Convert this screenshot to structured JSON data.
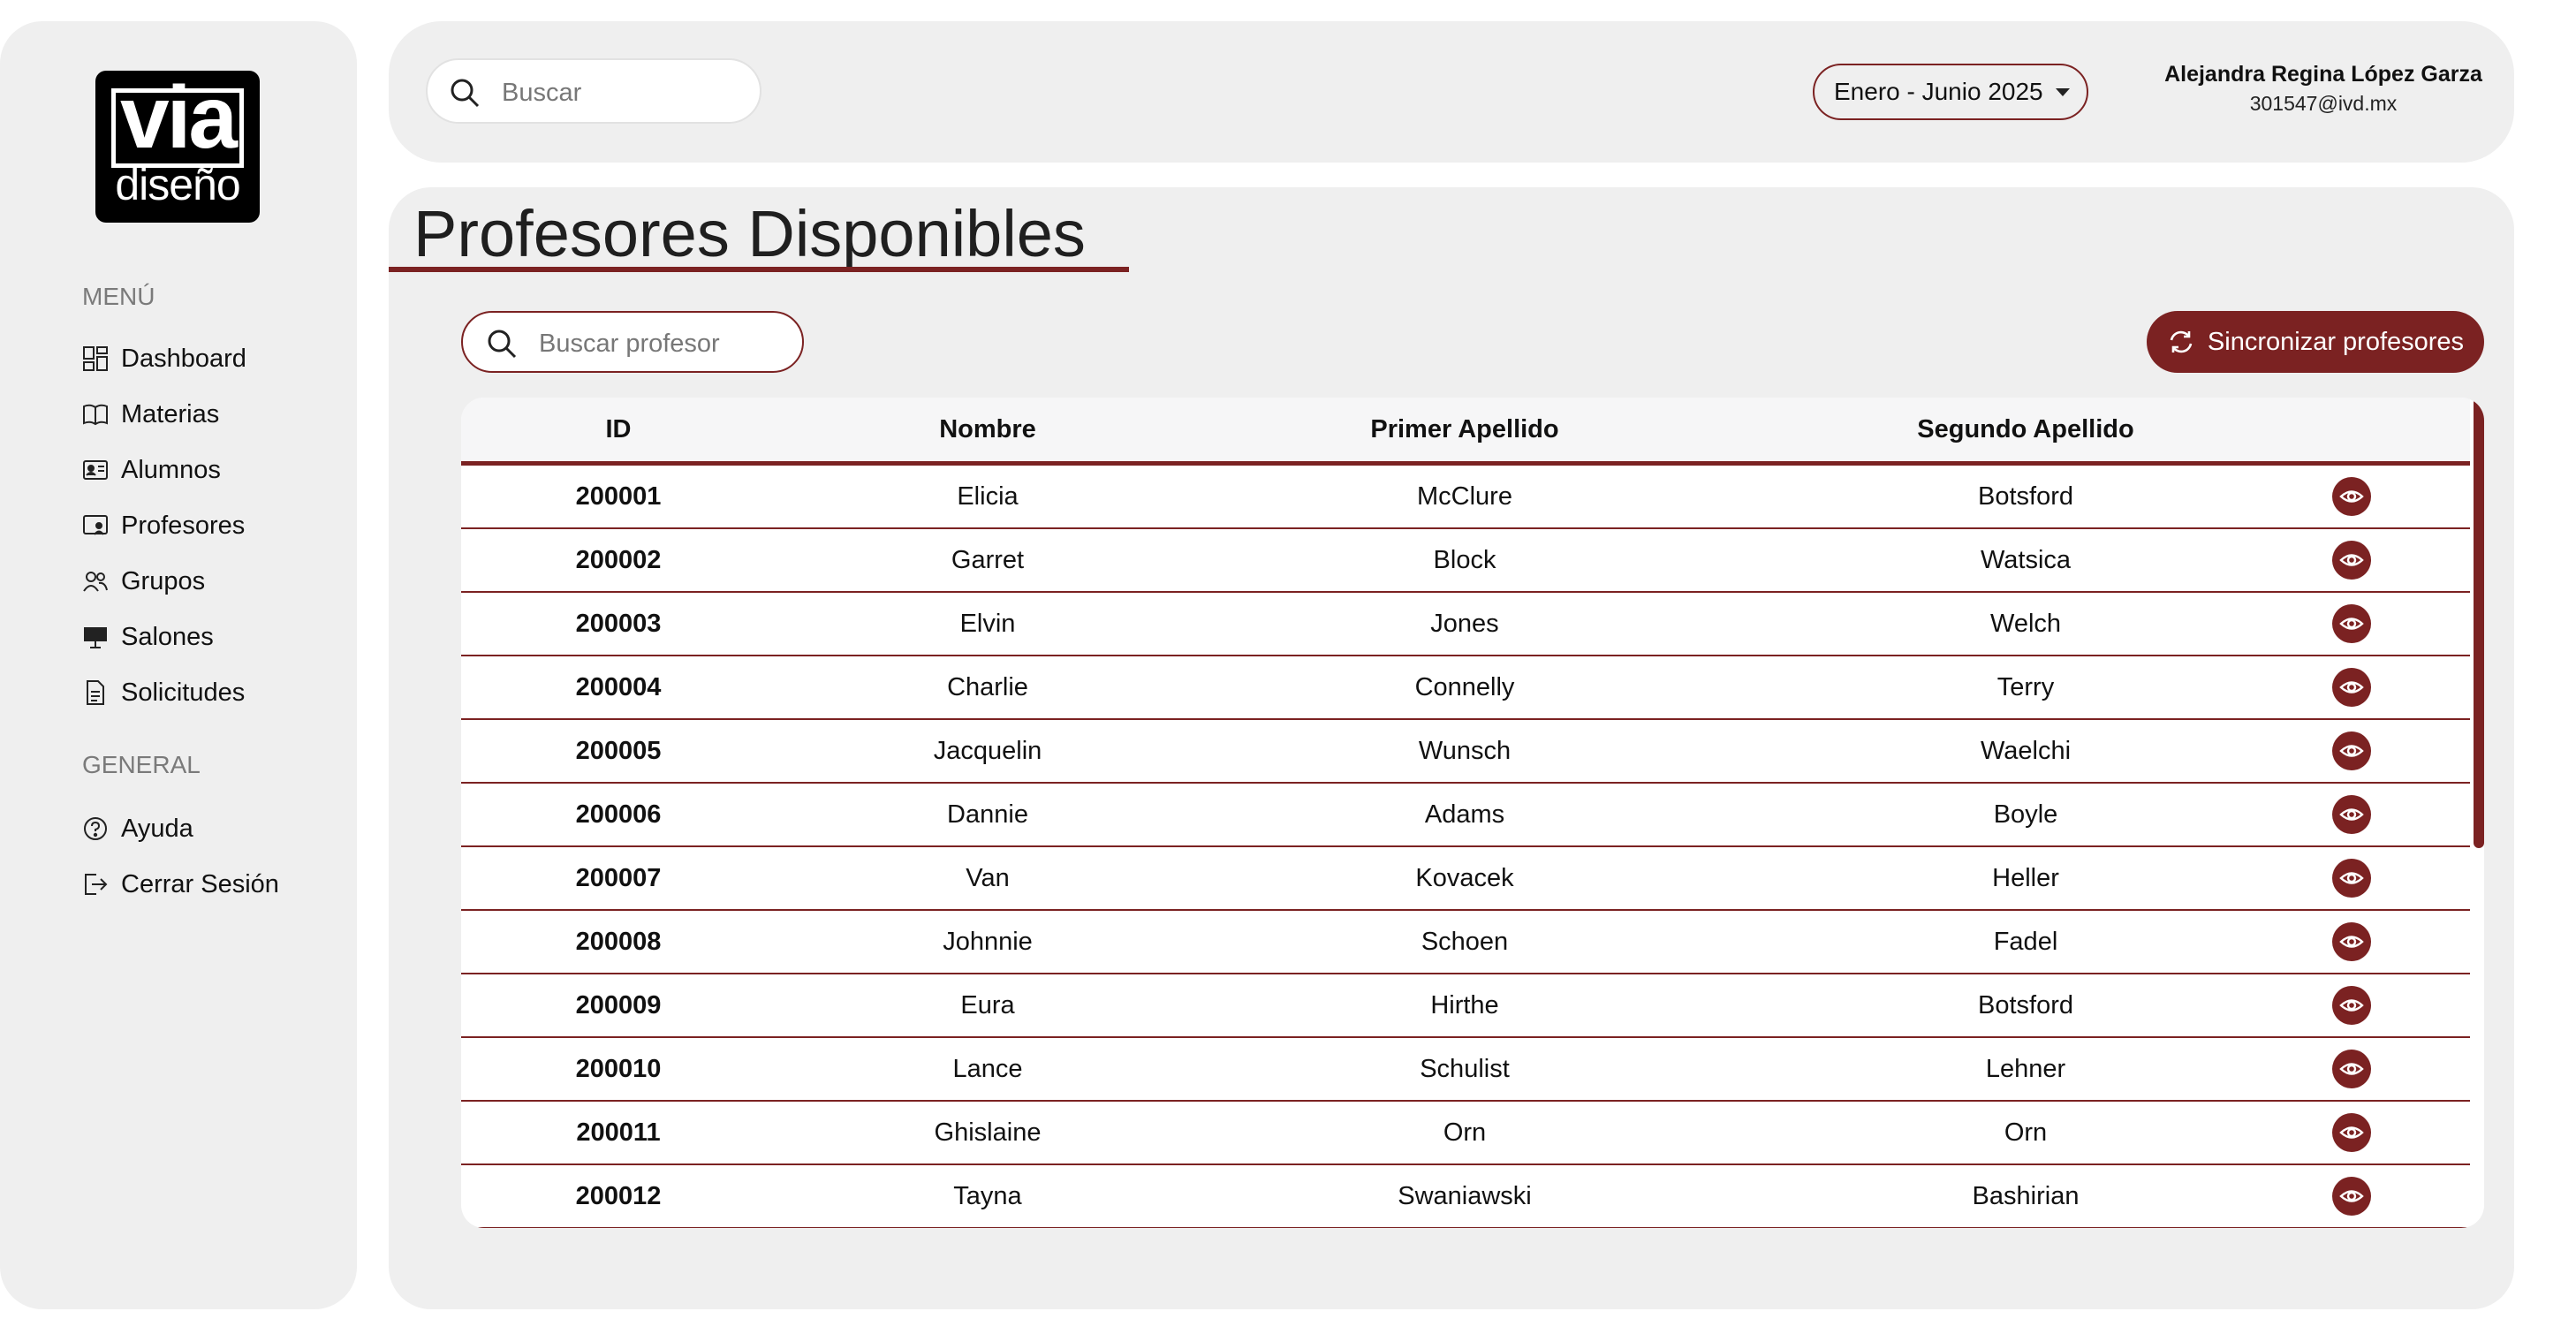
{
  "logo": {
    "line1": "via",
    "line2": "diseño"
  },
  "sidebar": {
    "menu_label": "MENÚ",
    "menu_items": [
      {
        "label": "Dashboard",
        "icon": "dashboard-icon"
      },
      {
        "label": "Materias",
        "icon": "book-icon"
      },
      {
        "label": "Alumnos",
        "icon": "id-card-icon"
      },
      {
        "label": "Profesores",
        "icon": "teacher-icon"
      },
      {
        "label": "Grupos",
        "icon": "users-icon"
      },
      {
        "label": "Salones",
        "icon": "classroom-icon"
      },
      {
        "label": "Solicitudes",
        "icon": "document-icon"
      }
    ],
    "general_label": "GENERAL",
    "general_items": [
      {
        "label": "Ayuda",
        "icon": "help-icon"
      },
      {
        "label": "Cerrar Sesión",
        "icon": "logout-icon"
      }
    ]
  },
  "topbar": {
    "search_placeholder": "Buscar",
    "period": "Enero - Junio 2025",
    "user_name": "Alejandra Regina López Garza",
    "user_email": "301547@ivd.mx"
  },
  "main": {
    "title": "Profesores Disponibles",
    "search_placeholder": "Buscar profesor",
    "sync_label": "Sincronizar profesores",
    "table": {
      "columns": [
        "ID",
        "Nombre",
        "Primer Apellido",
        "Segundo Apellido"
      ],
      "rows": [
        [
          "200001",
          "Elicia",
          "McClure",
          "Botsford"
        ],
        [
          "200002",
          "Garret",
          "Block",
          "Watsica"
        ],
        [
          "200003",
          "Elvin",
          "Jones",
          "Welch"
        ],
        [
          "200004",
          "Charlie",
          "Connelly",
          "Terry"
        ],
        [
          "200005",
          "Jacquelin",
          "Wunsch",
          "Waelchi"
        ],
        [
          "200006",
          "Dannie",
          "Adams",
          "Boyle"
        ],
        [
          "200007",
          "Van",
          "Kovacek",
          "Heller"
        ],
        [
          "200008",
          "Johnnie",
          "Schoen",
          "Fadel"
        ],
        [
          "200009",
          "Eura",
          "Hirthe",
          "Botsford"
        ],
        [
          "200010",
          "Lance",
          "Schulist",
          "Lehner"
        ],
        [
          "200011",
          "Ghislaine",
          "Orn",
          "Orn"
        ],
        [
          "200012",
          "Tayna",
          "Swaniawski",
          "Bashirian"
        ]
      ]
    }
  },
  "colors": {
    "accent": "#7b2222",
    "panel": "#efefef",
    "header_bg": "#f6f6f7"
  }
}
